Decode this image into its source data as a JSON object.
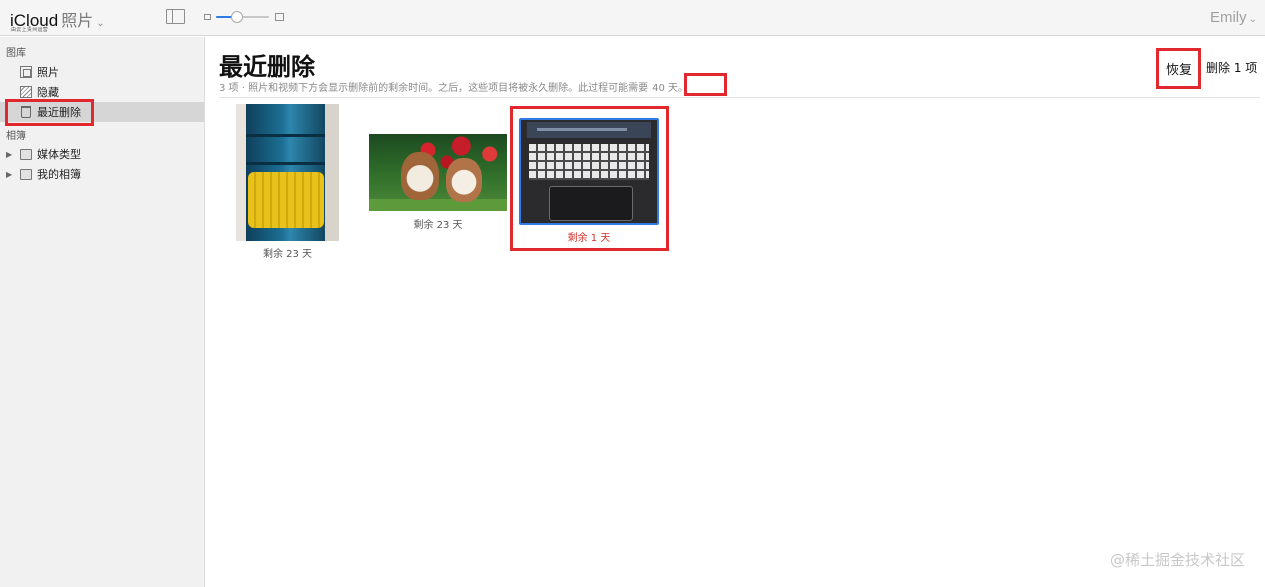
{
  "toolbar": {
    "brand": "iCloud",
    "app_name": "照片",
    "provider_note": "由云上贵州运营",
    "zoom_level": 0.4,
    "user_name": "Emily"
  },
  "sidebar": {
    "library_header": "图库",
    "library_items": [
      {
        "label": "照片",
        "icon": "photos-icon"
      },
      {
        "label": "隐藏",
        "icon": "hidden-icon"
      },
      {
        "label": "最近删除",
        "icon": "trash-icon",
        "selected": true
      }
    ],
    "albums_header": "相簿",
    "album_items": [
      {
        "label": "媒体类型",
        "icon": "folder-icon"
      },
      {
        "label": "我的相簿",
        "icon": "folder-icon"
      }
    ]
  },
  "main": {
    "title": "最近删除",
    "subtitle": "3 项 · 照片和视频下方会显示删除前的剩余时间。之后，这些项目将被永久删除。此过程可能需要",
    "subtitle_days": "40 天。",
    "recover_label": "恢复",
    "delete_label": "删除 1 项",
    "photos": [
      {
        "caption": "剩余 23 天",
        "subject": "blue bottle",
        "selected": false
      },
      {
        "caption": "剩余 23 天",
        "subject": "puppies",
        "selected": false
      },
      {
        "caption": "剩余 1 天",
        "subject": "laptop keyboard",
        "selected": true
      }
    ]
  },
  "annotation_color": "#e0282e",
  "accent_color": "#2f7ae5",
  "watermark": "@稀土掘金技术社区"
}
